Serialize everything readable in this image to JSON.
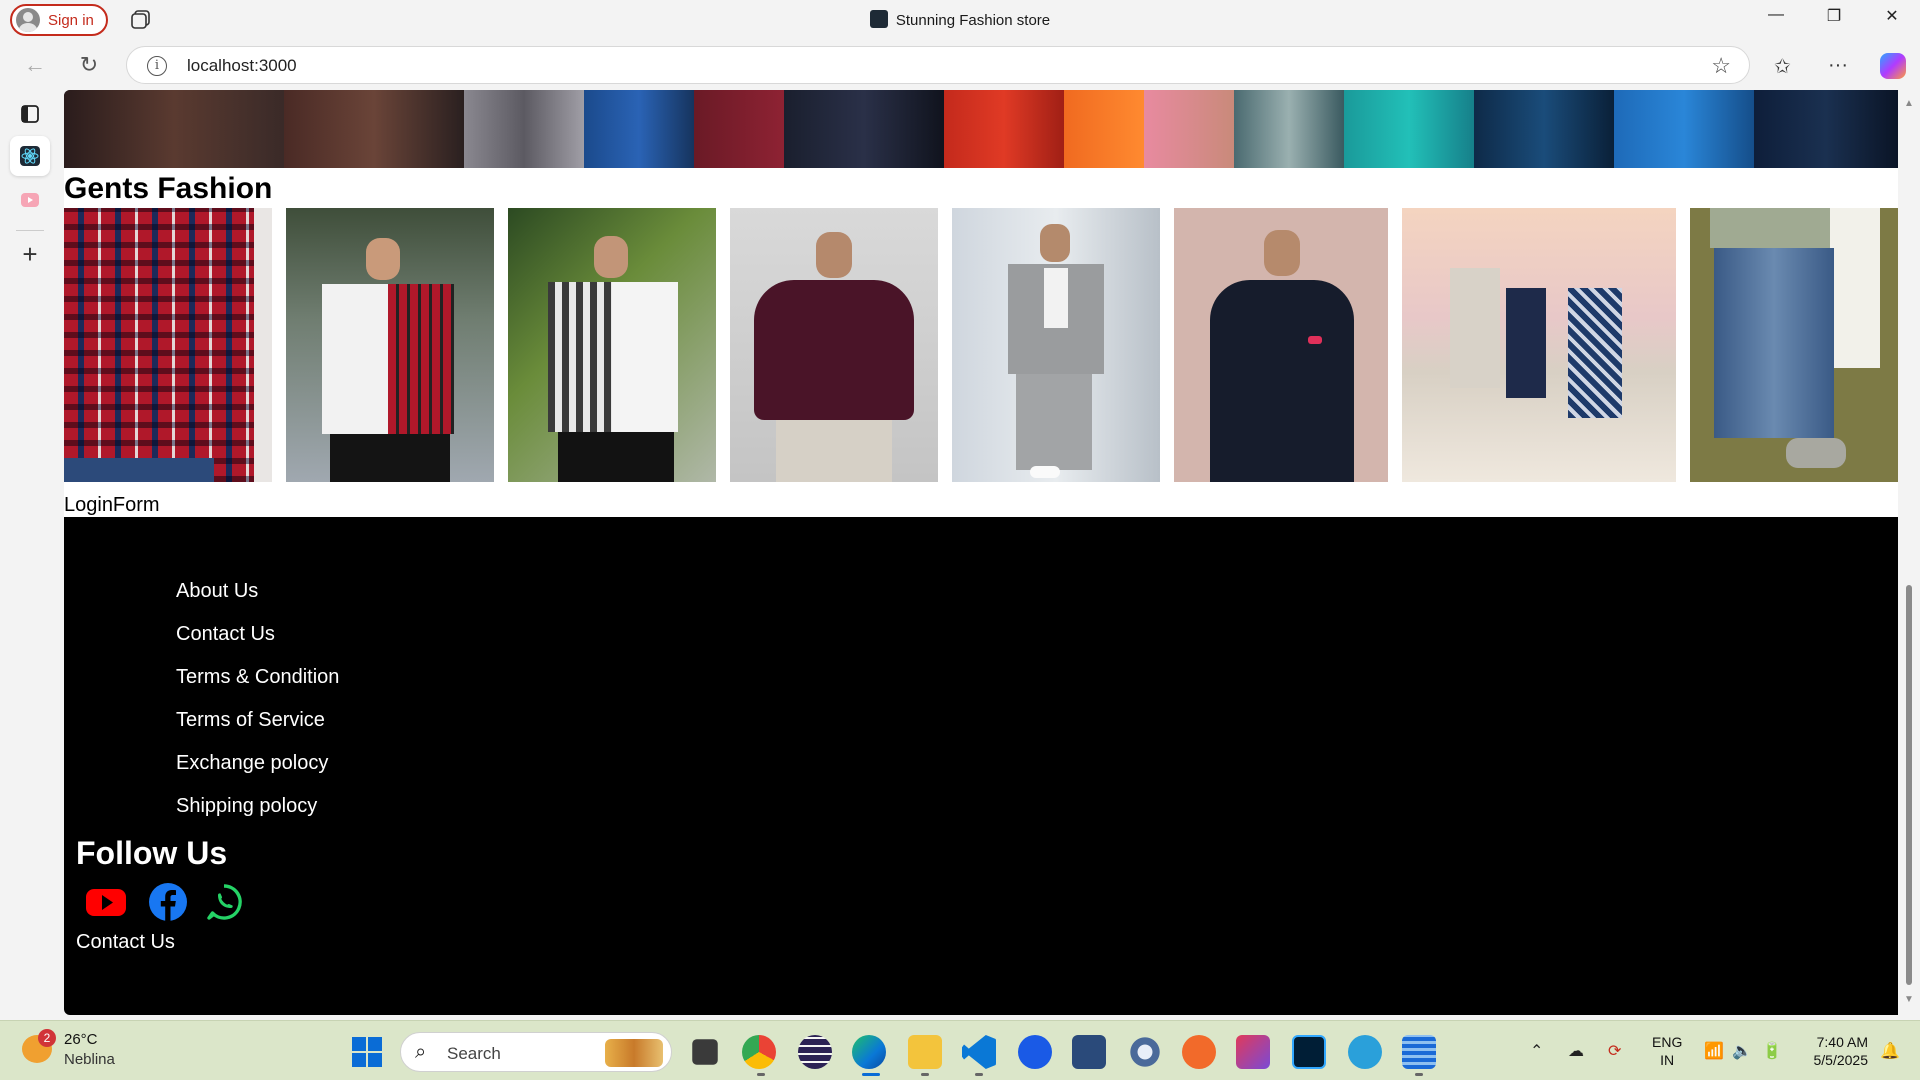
{
  "browser": {
    "signin_label": "Sign in",
    "window_title": "Stunning Fashion store",
    "url": "localhost:3000",
    "window_controls": {
      "minimize": "—",
      "restore": "❐",
      "close": "✕"
    }
  },
  "page": {
    "section_title": "Gents Fashion",
    "gallery_images": [
      {
        "name": "red-check-shirt"
      },
      {
        "name": "red-white-shirt"
      },
      {
        "name": "check-white-shirt"
      },
      {
        "name": "maroon-shirt"
      },
      {
        "name": "grey-suit"
      },
      {
        "name": "navy-bandhgala"
      },
      {
        "name": "beach-group"
      },
      {
        "name": "ripped-jeans"
      }
    ],
    "login_form_label": "LoginForm",
    "footer": {
      "links": [
        "About Us",
        "Contact Us",
        "Terms & Condition",
        "Terms of Service",
        "Exchange polocy",
        "Shipping polocy"
      ],
      "follow_title": "Follow Us",
      "socials": [
        {
          "icon": "youtube-icon",
          "color": "#ff0000"
        },
        {
          "icon": "facebook-icon",
          "color": "#1877f2"
        },
        {
          "icon": "whatsapp-icon",
          "color": "#25d366"
        }
      ],
      "contact_label": "Contact Us"
    }
  },
  "taskbar": {
    "weather_badge": "2",
    "weather_temp": "26°C",
    "weather_cond": "Neblina",
    "search_label": "Search",
    "lang_line1": "ENG",
    "lang_line2": "IN",
    "time": "7:40 AM",
    "date": "5/5/2025"
  },
  "colors": {
    "accent": "#0a6cd6",
    "signin": "#c42b1c",
    "footer_bg": "#000000"
  }
}
